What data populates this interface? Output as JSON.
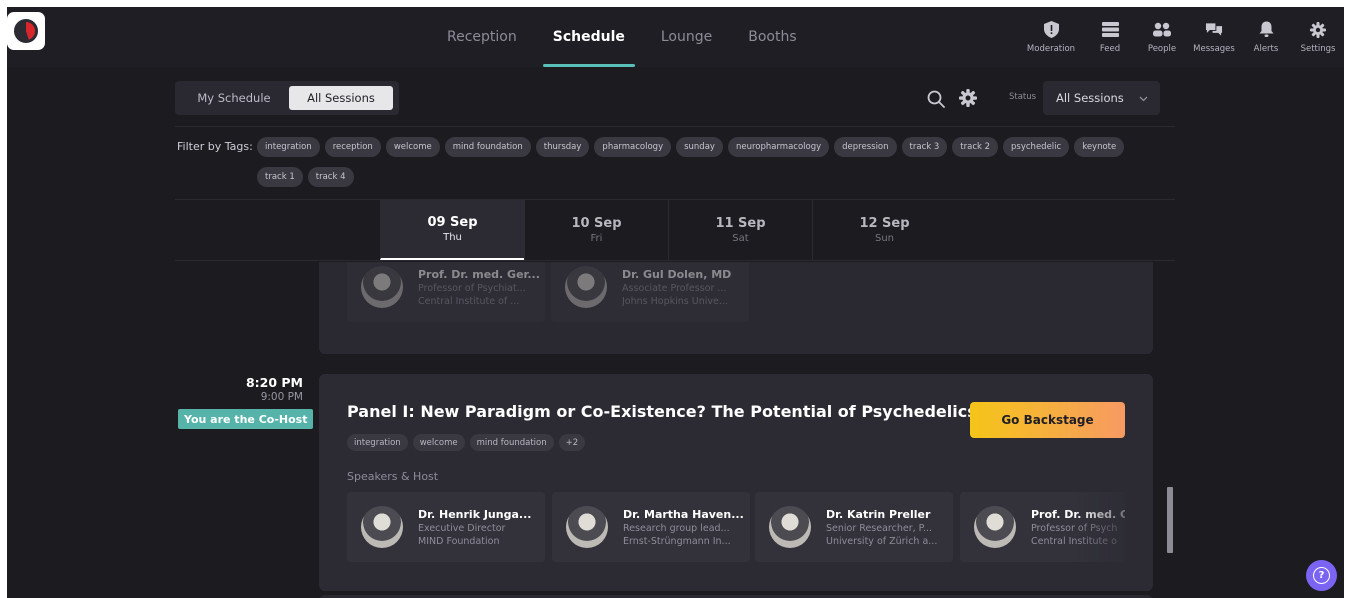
{
  "nav": {
    "tabs": [
      {
        "label": "Reception",
        "active": false
      },
      {
        "label": "Schedule",
        "active": true
      },
      {
        "label": "Lounge",
        "active": false
      },
      {
        "label": "Booths",
        "active": false
      }
    ],
    "right": [
      {
        "label": "Moderation",
        "icon": "shield-icon"
      },
      {
        "label": "Feed",
        "icon": "feed-icon"
      },
      {
        "label": "People",
        "icon": "people-icon"
      },
      {
        "label": "Messages",
        "icon": "messages-icon"
      },
      {
        "label": "Alerts",
        "icon": "bell-icon"
      },
      {
        "label": "Settings",
        "icon": "gear-icon"
      }
    ],
    "accent": "#58c0b8"
  },
  "toolbar": {
    "my_schedule": "My Schedule",
    "all_sessions": "All Sessions",
    "status_label": "Status",
    "status_value": "All Sessions"
  },
  "filters": {
    "label": "Filter by Tags:",
    "tags": [
      "integration",
      "reception",
      "welcome",
      "mind foundation",
      "thursday",
      "pharmacology",
      "sunday",
      "neuropharmacology",
      "depression",
      "track 3",
      "track 2",
      "psychedelic",
      "keynote",
      "track 1",
      "track 4"
    ]
  },
  "dates": [
    {
      "day": "09 Sep",
      "weekday": "Thu",
      "active": true
    },
    {
      "day": "10 Sep",
      "weekday": "Fri",
      "active": false
    },
    {
      "day": "11 Sep",
      "weekday": "Sat",
      "active": false
    },
    {
      "day": "12 Sep",
      "weekday": "Sun",
      "active": false
    }
  ],
  "previous_session": {
    "speakers": [
      {
        "name": "Prof. Dr. med. Ger...",
        "title": "Professor of Psychiat...",
        "org": "Central Institute of ..."
      },
      {
        "name": "Dr. Gul Dolen, MD",
        "title": "Associate Professor ...",
        "org": "Johns Hopkins Unive..."
      }
    ]
  },
  "session": {
    "start": "8:20 PM",
    "end": "9:00 PM",
    "badge": "You are the Co-Host",
    "title": "Panel I: New Paradigm or Co-Existence? The Potential of Psychedelics i...",
    "cta": "Go Backstage",
    "tags": [
      "integration",
      "welcome",
      "mind foundation",
      "+2"
    ],
    "speakers_label": "Speakers & Host",
    "speakers": [
      {
        "name": "Dr. Henrik Junga...",
        "title": "Executive Director",
        "org": "MIND Foundation"
      },
      {
        "name": "Dr. Martha Haven...",
        "title": "Research group lead...",
        "org": "Ernst-Strüngmann In..."
      },
      {
        "name": "Dr. Katrin Preller",
        "title": "Senior Researcher, P...",
        "org": "University of Zürich a..."
      },
      {
        "name": "Prof. Dr. med. Ge",
        "title": "Professor of Psych",
        "org": "Central Institute o"
      }
    ]
  },
  "help": {
    "label": "?"
  }
}
